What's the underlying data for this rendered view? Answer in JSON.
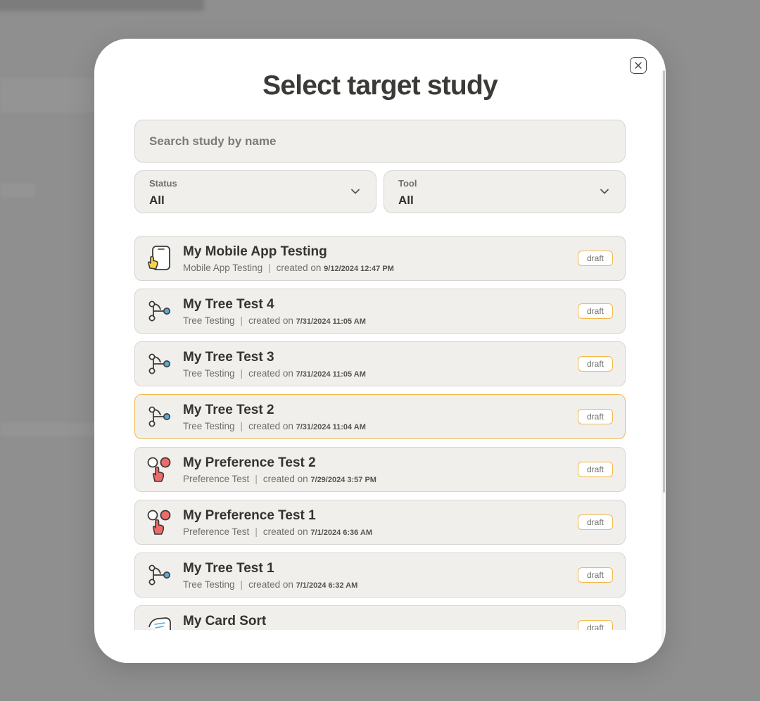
{
  "modal": {
    "title": "Select target study",
    "close_label": "×"
  },
  "search": {
    "placeholder": "Search study by name",
    "value": ""
  },
  "filters": {
    "status": {
      "label": "Status",
      "value": "All"
    },
    "tool": {
      "label": "Tool",
      "value": "All"
    }
  },
  "studies": [
    {
      "name": "My Mobile App Testing",
      "tool": "Mobile App Testing",
      "created_prefix": "created on",
      "created": "9/12/2024 12:47 PM",
      "status": "draft",
      "icon": "mobile-app-icon",
      "selected": false
    },
    {
      "name": "My Tree Test 4",
      "tool": "Tree Testing",
      "created_prefix": "created on",
      "created": "7/31/2024 11:05 AM",
      "status": "draft",
      "icon": "tree-testing-icon",
      "selected": false
    },
    {
      "name": "My Tree Test 3",
      "tool": "Tree Testing",
      "created_prefix": "created on",
      "created": "7/31/2024 11:05 AM",
      "status": "draft",
      "icon": "tree-testing-icon",
      "selected": false
    },
    {
      "name": "My Tree Test 2",
      "tool": "Tree Testing",
      "created_prefix": "created on",
      "created": "7/31/2024 11:04 AM",
      "status": "draft",
      "icon": "tree-testing-icon",
      "selected": true
    },
    {
      "name": "My Preference Test 2",
      "tool": "Preference Test",
      "created_prefix": "created on",
      "created": "7/29/2024 3:57 PM",
      "status": "draft",
      "icon": "preference-test-icon",
      "selected": false
    },
    {
      "name": "My Preference Test 1",
      "tool": "Preference Test",
      "created_prefix": "created on",
      "created": "7/1/2024 6:36 AM",
      "status": "draft",
      "icon": "preference-test-icon",
      "selected": false
    },
    {
      "name": "My Tree Test 1",
      "tool": "Tree Testing",
      "created_prefix": "created on",
      "created": "7/1/2024 6:32 AM",
      "status": "draft",
      "icon": "tree-testing-icon",
      "selected": false
    },
    {
      "name": "My Card Sort",
      "tool": "",
      "created_prefix": "",
      "created": "",
      "status": "draft",
      "icon": "card-sort-icon",
      "selected": false
    }
  ],
  "colors": {
    "accent": "#f2b84b",
    "row_bg": "#f0efec",
    "tree_node": "#5aa9d6",
    "preference_dot": "#ef6b6b",
    "mobile_finger": "#f6d34a"
  }
}
